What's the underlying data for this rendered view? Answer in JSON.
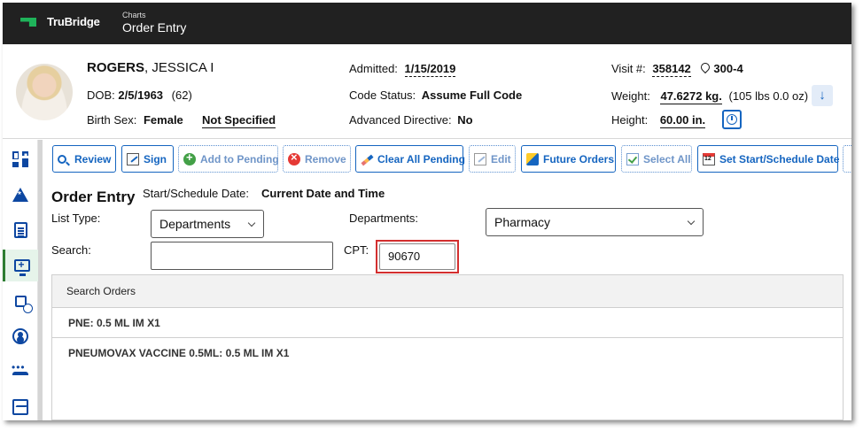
{
  "header": {
    "brand": "TruBridge",
    "crumb_small": "Charts",
    "crumb_title": "Order Entry"
  },
  "patient": {
    "last_name": "ROGERS",
    "first_name": ", JESSICA I",
    "dob_label": "DOB:",
    "dob": "2/5/1963",
    "age": "(62)",
    "birth_sex_label": "Birth Sex:",
    "birth_sex": "Female",
    "gender_identity": "Not Specified",
    "admitted_label": "Admitted:",
    "admitted": "1/15/2019",
    "code_status_label": "Code Status:",
    "code_status": "Assume Full Code",
    "advanced_directive_label": "Advanced Directive:",
    "advanced_directive": "No",
    "visit_label": "Visit #:",
    "visit": "358142",
    "room": "300-4",
    "weight_label": "Weight:",
    "weight": "47.6272 kg.",
    "weight_lbs": "(105 lbs 0.0 oz)",
    "height_label": "Height:",
    "height": "60.00 in."
  },
  "sidebar": {
    "icons": [
      "dashboard-icon",
      "alert-triangle-icon",
      "document-icon",
      "order-entry-icon",
      "schedule-icon",
      "person-icon",
      "people-icon",
      "vitals-icon"
    ]
  },
  "toolbar": {
    "review": "Review",
    "sign": "Sign",
    "add_to_pending": "Add to Pending",
    "remove": "Remove",
    "clear_all_pending": "Clear All Pending",
    "edit": "Edit",
    "future_orders": "Future Orders",
    "select_all": "Select All",
    "set_start": "Set Start/Schedule Date"
  },
  "form": {
    "title": "Order Entry",
    "start_label": "Start/Schedule Date:",
    "start_value": "Current Date and Time",
    "list_type_label": "List Type:",
    "list_type_value": "Departments",
    "departments_label": "Departments:",
    "departments_value": "Pharmacy",
    "search_label": "Search:",
    "search_value": "",
    "cpt_label": "CPT:",
    "cpt_value": "90670"
  },
  "orders": {
    "header": "Search Orders",
    "rows": [
      "PNE: 0.5 ML IM X1",
      "PNEUMOVAX VACCINE 0.5ML: 0.5 ML IM X1"
    ]
  },
  "colors": {
    "accent": "#1565c0",
    "header_bg": "#212121",
    "brand_green": "#1fb35a",
    "highlight": "#d32f2f"
  }
}
